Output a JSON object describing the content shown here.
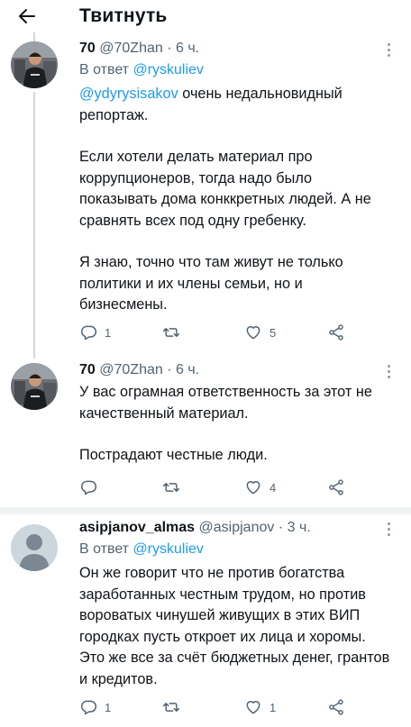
{
  "header": {
    "title": "Твитнуть"
  },
  "tweets": [
    {
      "name": "70",
      "handle": "@70Zhan",
      "time": "· 6 ч.",
      "reply_prefix": "В ответ ",
      "reply_to": "@ryskuliev",
      "mention": "@ydyrysisakov",
      "paragraphs": [
        " очень недальновидный репортаж.",
        "Если хотели делать материал про коррупционеров, тогда надо было показывать дома конккретных людей. А не сравнять всех под одну гребенку.",
        "Я знаю, точно что там живут не только политики и их члены семьи, но и бизнесмены."
      ],
      "replies": "1",
      "retweets": "",
      "likes": "5"
    },
    {
      "name": "70",
      "handle": "@70Zhan",
      "time": "· 6 ч.",
      "paragraphs": [
        "У вас ограмная ответственность за этот не качественный материал.",
        "Пострадают честные люди."
      ],
      "replies": "",
      "retweets": "",
      "likes": "4"
    },
    {
      "name": "asipjanov_almas",
      "handle": "@asipjanov",
      "time": "· 3 ч.",
      "reply_prefix": "В ответ ",
      "reply_to": "@ryskuliev",
      "paragraphs": [
        "Он же говорит что не против богатства заработанных честным трудом, но против вороватых чинушей живущих в этих ВИП городках пусть откроет их лица и хоромы. Это же все за счёт бюджетных денег, грантов и кредитов."
      ],
      "replies": "1",
      "retweets": "",
      "likes": "1"
    }
  ],
  "icons": [
    "back-arrow-icon",
    "more-icon",
    "reply-icon",
    "retweet-icon",
    "like-icon",
    "share-icon"
  ],
  "colors": {
    "link": "#1d9bf0",
    "muted": "#536471",
    "separator": "#eff3f4"
  }
}
